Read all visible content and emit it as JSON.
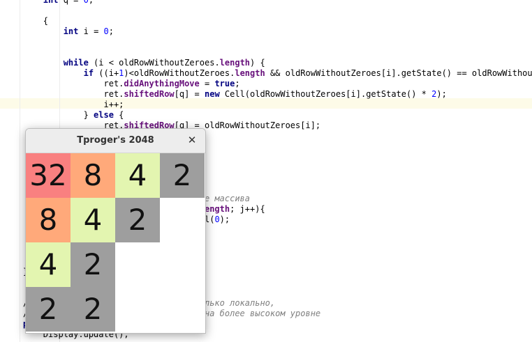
{
  "editor": {
    "lines": [
      [
        {
          "t": "        "
        },
        {
          "t": "int",
          "c": "kw"
        },
        {
          "t": " q = "
        },
        {
          "t": "0",
          "c": "num"
        },
        {
          "t": ";"
        }
      ],
      [],
      [
        {
          "t": "        {"
        }
      ],
      [
        {
          "t": "            "
        },
        {
          "t": "int",
          "c": "kw"
        },
        {
          "t": " i = "
        },
        {
          "t": "0",
          "c": "num"
        },
        {
          "t": ";"
        }
      ],
      [],
      [],
      [
        {
          "t": "            "
        },
        {
          "t": "while",
          "c": "kw"
        },
        {
          "t": " (i < oldRowWithoutZeroes."
        },
        {
          "t": "length",
          "c": "fld"
        },
        {
          "t": ") {"
        }
      ],
      [
        {
          "t": "                "
        },
        {
          "t": "if",
          "c": "kw"
        },
        {
          "t": " ((i+"
        },
        {
          "t": "1",
          "c": "num"
        },
        {
          "t": ")<oldRowWithoutZeroes."
        },
        {
          "t": "length",
          "c": "fld"
        },
        {
          "t": " && oldRowWithoutZeroes[i].getState() == oldRowWithout"
        }
      ],
      [
        {
          "t": "                    ret."
        },
        {
          "t": "didAnythingMove",
          "c": "fld"
        },
        {
          "t": " = "
        },
        {
          "t": "true",
          "c": "kw"
        },
        {
          "t": ";"
        }
      ],
      [
        {
          "t": "                    ret."
        },
        {
          "t": "shiftedRow",
          "c": "fld"
        },
        {
          "t": "[q] = "
        },
        {
          "t": "new",
          "c": "kw"
        },
        {
          "t": " Cell(oldRowWithoutZeroes[i].getState() * "
        },
        {
          "t": "2",
          "c": "num"
        },
        {
          "t": ");"
        }
      ],
      [
        {
          "t": "                    i++;"
        }
      ],
      [
        {
          "t": "                } "
        },
        {
          "t": "else",
          "c": "kw"
        },
        {
          "t": " {"
        }
      ],
      [
        {
          "t": "                    ret."
        },
        {
          "t": "shiftedRow",
          "c": "fld"
        },
        {
          "t": "[q] = oldRowWithoutZeroes[i];"
        }
      ],
      [],
      [],
      [],
      [],
      [],
      [],
      [
        {
          "t": "                                        "
        },
        {
          "t": "е массива",
          "c": "cmt"
        }
      ],
      [
        {
          "t": "                                        "
        },
        {
          "t": "ength",
          "c": "fld"
        },
        {
          "t": "; j++){"
        }
      ],
      [
        {
          "t": "                                        l("
        },
        {
          "t": "0",
          "c": "num"
        },
        {
          "t": ");"
        }
      ],
      [],
      [],
      [],
      [],
      [
        {
          "t": "    }"
        }
      ],
      [],
      [],
      [
        {
          "t": "    //                                  "
        },
        {
          "t": "лько локально,",
          "c": "cmt"
        }
      ],
      [
        {
          "t": "    //                                  "
        },
        {
          "t": "на более высоком уровне",
          "c": "cmt"
        }
      ],
      [
        {
          "t": "    "
        },
        {
          "t": "private static void",
          "c": "kw"
        },
        {
          "t": " updateOpenGL() {"
        }
      ],
      [
        {
          "t": "        Display.update();"
        }
      ]
    ]
  },
  "window": {
    "title": "Tproger's 2048",
    "close_glyph": "✕"
  },
  "board": {
    "rows": [
      [
        "32",
        "8",
        "4",
        "2"
      ],
      [
        "8",
        "4",
        "2",
        ""
      ],
      [
        "4",
        "2",
        "",
        ""
      ],
      [
        "2",
        "2",
        "",
        ""
      ]
    ],
    "colors": {
      "2": "#9e9e9e",
      "4": "#e3f5b0",
      "8": "#ffa97a",
      "32": "#f98080",
      "empty": "#ffffff"
    }
  }
}
